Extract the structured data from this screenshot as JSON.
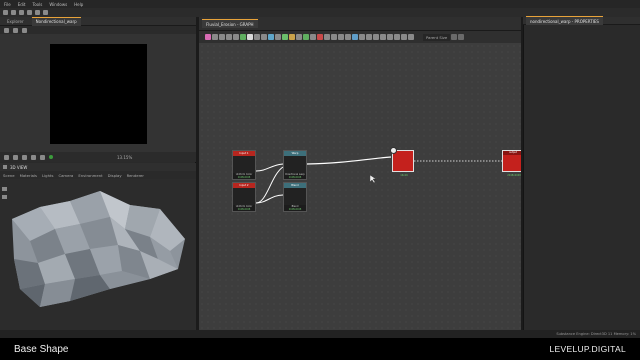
{
  "menubar": {
    "items": [
      "File",
      "Edit",
      "Tools",
      "Windows",
      "Help"
    ]
  },
  "explorer": {
    "tabs": [
      "Explorer",
      "Nondirectional_warp"
    ]
  },
  "viewer2d": {
    "zoom": "13.15%"
  },
  "viewer3d": {
    "title": "3D VIEW",
    "menu": [
      "Scene",
      "Materials",
      "Lights",
      "Camera",
      "Environment",
      "Display",
      "Renderer"
    ]
  },
  "graph": {
    "tab_title": "Fluvial_Erosion - GRAPH",
    "parent_size_label": "Parent Size",
    "nodes": [
      {
        "id": "n1",
        "header": "Input 1",
        "label": "Uniform Color",
        "size": "2048x2048",
        "header_color": "#b7261f"
      },
      {
        "id": "n2",
        "header": "Warp",
        "label": "Directional warp",
        "size": "2048x2048",
        "header_color": "#3d6f7a"
      },
      {
        "id": "n3",
        "header": "Input 2",
        "label": "Uniform Color",
        "size": "2048x2048",
        "header_color": "#b7261f"
      },
      {
        "id": "n4",
        "header": "Blend",
        "label": "Blend",
        "size": "2048x2048",
        "header_color": "#3d6f7a"
      },
      {
        "id": "n5",
        "header": "",
        "label": "",
        "size": "16x16",
        "header_color": "#c4211d"
      },
      {
        "id": "n6",
        "header": "output",
        "label": "",
        "size": "2048x2048",
        "header_color": "#8a1512"
      }
    ]
  },
  "properties": {
    "title": "nondirectional_warp - PROPERTIES"
  },
  "statusbar": {
    "text": "Substance Engine: Direct3D 11   Memory: 1%"
  },
  "caption": {
    "title": "Base Shape",
    "brand": "LEVELUP.DIGITAL"
  },
  "colors": {
    "accent": "#e8a33a",
    "node_red": "#c4211d",
    "link": "#ffffff"
  }
}
